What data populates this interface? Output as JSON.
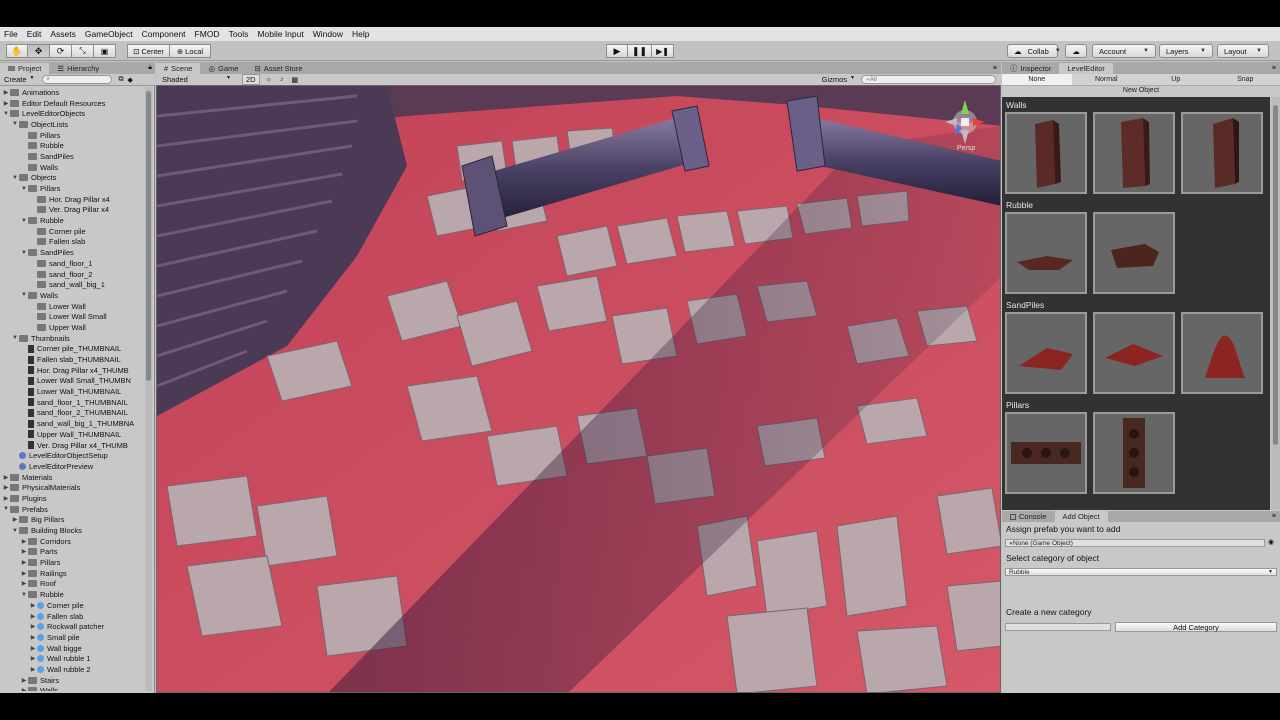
{
  "menu": [
    "File",
    "Edit",
    "Assets",
    "GameObject",
    "Component",
    "FMOD",
    "Tools",
    "Mobile Input",
    "Window",
    "Help"
  ],
  "toolbar": {
    "pivot_label": "Center",
    "space_label": "Local",
    "collab_label": "Collab",
    "account_label": "Account",
    "layers_label": "Layers",
    "layout_label": "Layout"
  },
  "project": {
    "tabs": [
      "Project",
      "Hierarchy"
    ],
    "create_label": "Create",
    "tree": [
      {
        "label": "Animations",
        "depth": 0,
        "tri": "▶",
        "icon": "folder"
      },
      {
        "label": "Editor Default Resources",
        "depth": 0,
        "tri": "▶",
        "icon": "folder"
      },
      {
        "label": "LevelEditorObjects",
        "depth": 0,
        "tri": "▼",
        "icon": "folder"
      },
      {
        "label": "ObjectLists",
        "depth": 1,
        "tri": "▼",
        "icon": "folder"
      },
      {
        "label": "Pillars",
        "depth": 2,
        "tri": "",
        "icon": "folder"
      },
      {
        "label": "Rubble",
        "depth": 2,
        "tri": "",
        "icon": "folder"
      },
      {
        "label": "SandPiles",
        "depth": 2,
        "tri": "",
        "icon": "folder"
      },
      {
        "label": "Walls",
        "depth": 2,
        "tri": "",
        "icon": "folder"
      },
      {
        "label": "Objects",
        "depth": 1,
        "tri": "▼",
        "icon": "folder"
      },
      {
        "label": "Pillars",
        "depth": 2,
        "tri": "▼",
        "icon": "folder"
      },
      {
        "label": "Hor. Drag Pillar x4",
        "depth": 3,
        "tri": "",
        "icon": "folder"
      },
      {
        "label": "Ver. Drag Pillar x4",
        "depth": 3,
        "tri": "",
        "icon": "folder"
      },
      {
        "label": "Rubble",
        "depth": 2,
        "tri": "▼",
        "icon": "folder"
      },
      {
        "label": "Corner pile",
        "depth": 3,
        "tri": "",
        "icon": "folder"
      },
      {
        "label": "Fallen slab",
        "depth": 3,
        "tri": "",
        "icon": "folder"
      },
      {
        "label": "SandPiles",
        "depth": 2,
        "tri": "▼",
        "icon": "folder"
      },
      {
        "label": "sand_floor_1",
        "depth": 3,
        "tri": "",
        "icon": "folder"
      },
      {
        "label": "sand_floor_2",
        "depth": 3,
        "tri": "",
        "icon": "folder"
      },
      {
        "label": "sand_wall_big_1",
        "depth": 3,
        "tri": "",
        "icon": "folder"
      },
      {
        "label": "Walls",
        "depth": 2,
        "tri": "▼",
        "icon": "folder"
      },
      {
        "label": "Lower Wall",
        "depth": 3,
        "tri": "",
        "icon": "folder"
      },
      {
        "label": "Lower Wall Small",
        "depth": 3,
        "tri": "",
        "icon": "folder"
      },
      {
        "label": "Upper Wall",
        "depth": 3,
        "tri": "",
        "icon": "folder"
      },
      {
        "label": "Thumbnails",
        "depth": 1,
        "tri": "▼",
        "icon": "folder"
      },
      {
        "label": "Corner pile_THUMBNAIL",
        "depth": 2,
        "tri": "",
        "icon": "thumb"
      },
      {
        "label": "Fallen slab_THUMBNAIL",
        "depth": 2,
        "tri": "",
        "icon": "thumb"
      },
      {
        "label": "Hor. Drag Pillar x4_THUMB",
        "depth": 2,
        "tri": "",
        "icon": "thumb"
      },
      {
        "label": "Lower Wall Small_THUMBN",
        "depth": 2,
        "tri": "",
        "icon": "thumb"
      },
      {
        "label": "Lower Wall_THUMBNAIL",
        "depth": 2,
        "tri": "",
        "icon": "thumb"
      },
      {
        "label": "sand_floor_1_THUMBNAIL",
        "depth": 2,
        "tri": "",
        "icon": "thumb"
      },
      {
        "label": "sand_floor_2_THUMBNAIL",
        "depth": 2,
        "tri": "",
        "icon": "thumb"
      },
      {
        "label": "sand_wall_big_1_THUMBNA",
        "depth": 2,
        "tri": "",
        "icon": "thumb"
      },
      {
        "label": "Upper Wall_THUMBNAIL",
        "depth": 2,
        "tri": "",
        "icon": "thumb"
      },
      {
        "label": "Ver. Drag Pillar x4_THUMB",
        "depth": 2,
        "tri": "",
        "icon": "thumb"
      },
      {
        "label": "LevelEditorObjectSetup",
        "depth": 1,
        "tri": "",
        "icon": "obj"
      },
      {
        "label": "LevelEditorPreview",
        "depth": 1,
        "tri": "",
        "icon": "obj"
      },
      {
        "label": "Materials",
        "depth": 0,
        "tri": "▶",
        "icon": "folder"
      },
      {
        "label": "PhysicalMaterials",
        "depth": 0,
        "tri": "▶",
        "icon": "folder"
      },
      {
        "label": "Plugins",
        "depth": 0,
        "tri": "▶",
        "icon": "folder"
      },
      {
        "label": "Prefabs",
        "depth": 0,
        "tri": "▼",
        "icon": "folder"
      },
      {
        "label": "Big Pillars",
        "depth": 1,
        "tri": "▶",
        "icon": "folder"
      },
      {
        "label": "Building Blocks",
        "depth": 1,
        "tri": "▼",
        "icon": "folder"
      },
      {
        "label": "Corridors",
        "depth": 2,
        "tri": "▶",
        "icon": "folder"
      },
      {
        "label": "Parts",
        "depth": 2,
        "tri": "▶",
        "icon": "folder"
      },
      {
        "label": "Pillars",
        "depth": 2,
        "tri": "▶",
        "icon": "folder"
      },
      {
        "label": "Railings",
        "depth": 2,
        "tri": "▶",
        "icon": "folder"
      },
      {
        "label": "Roof",
        "depth": 2,
        "tri": "▶",
        "icon": "folder"
      },
      {
        "label": "Rubble",
        "depth": 2,
        "tri": "▼",
        "icon": "folder"
      },
      {
        "label": "Corner pile",
        "depth": 3,
        "tri": "▶",
        "icon": "prefab"
      },
      {
        "label": "Fallen slab",
        "depth": 3,
        "tri": "▶",
        "icon": "prefab"
      },
      {
        "label": "Rockwall patcher",
        "depth": 3,
        "tri": "▶",
        "icon": "prefab"
      },
      {
        "label": "Small pile",
        "depth": 3,
        "tri": "▶",
        "icon": "prefab"
      },
      {
        "label": "Wall bigge",
        "depth": 3,
        "tri": "▶",
        "icon": "prefab"
      },
      {
        "label": "Wall rubble 1",
        "depth": 3,
        "tri": "▶",
        "icon": "prefab"
      },
      {
        "label": "Wall rubble 2",
        "depth": 3,
        "tri": "▶",
        "icon": "prefab"
      },
      {
        "label": "Stairs",
        "depth": 2,
        "tri": "▶",
        "icon": "folder"
      },
      {
        "label": "Walls",
        "depth": 2,
        "tri": "▶",
        "icon": "folder"
      }
    ]
  },
  "scene": {
    "tabs": [
      "Scene",
      "Game",
      "Asset Store"
    ],
    "shading_mode": "Shaded",
    "mode_2d": "2D",
    "gizmos_label": "Gizmos",
    "search_placeholder": "All",
    "gizmo_view_label": "Persp",
    "colors": {
      "sand": "#c8455a",
      "stone": "#b8a8ac",
      "pillar": "#4a4266"
    }
  },
  "right_panel": {
    "tabs": [
      "Inspector",
      "LevelEditor"
    ],
    "modes": [
      "None",
      "Normal",
      "Up",
      "Snap"
    ],
    "palette_title": "New Object",
    "categories": [
      "Walls",
      "Rubble",
      "SandPiles",
      "Pillars"
    ],
    "lower_tabs": [
      "Console",
      "Add Object"
    ],
    "assign_label": "Assign prefab you want to add",
    "prefab_field": "None (Game Object)",
    "select_category_label": "Select category of object",
    "category_value": "Rubble",
    "create_category_label": "Create a new category",
    "add_category_button": "Add Category"
  }
}
